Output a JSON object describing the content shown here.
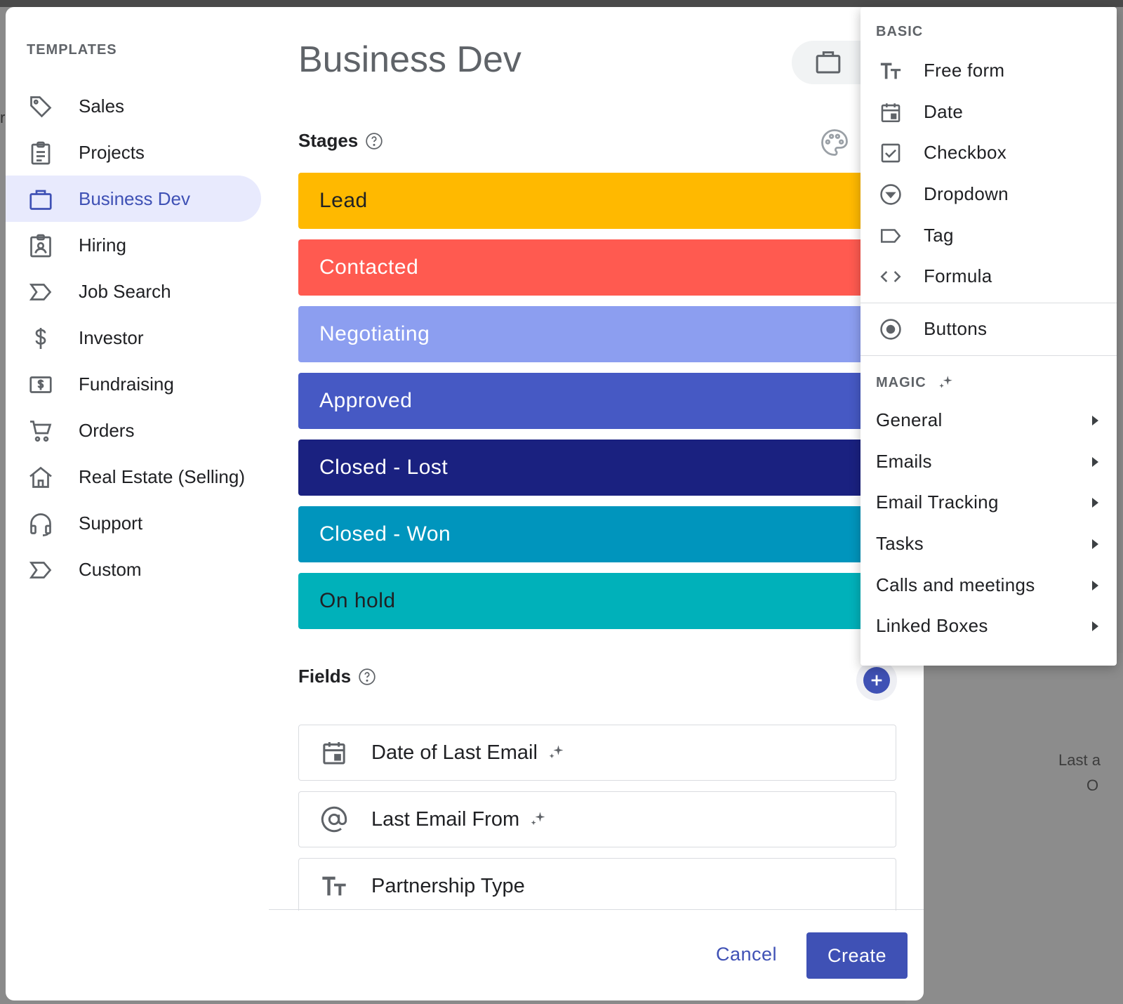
{
  "sidebar": {
    "title": "TEMPLATES",
    "items": [
      {
        "label": "Sales",
        "icon": "tag-icon"
      },
      {
        "label": "Projects",
        "icon": "clipboard-icon"
      },
      {
        "label": "Business Dev",
        "icon": "briefcase-icon",
        "active": true
      },
      {
        "label": "Hiring",
        "icon": "badge-icon"
      },
      {
        "label": "Job Search",
        "icon": "chevron-flag-icon"
      },
      {
        "label": "Investor",
        "icon": "dollar-icon"
      },
      {
        "label": "Fundraising",
        "icon": "money-icon"
      },
      {
        "label": "Orders",
        "icon": "cart-icon"
      },
      {
        "label": "Real Estate (Selling)",
        "icon": "home-icon"
      },
      {
        "label": "Support",
        "icon": "headset-icon"
      },
      {
        "label": "Custom",
        "icon": "chevron-flag-icon"
      }
    ]
  },
  "main": {
    "title": "Business Dev",
    "stages_label": "Stages",
    "stages": [
      {
        "label": "Lead",
        "bg": "#FFB900",
        "fg": "#202124"
      },
      {
        "label": "Contacted",
        "bg": "#FF5A50",
        "fg": "#FFFFFF"
      },
      {
        "label": "Negotiating",
        "bg": "#8C9EF0",
        "fg": "#FFFFFF"
      },
      {
        "label": "Approved",
        "bg": "#4659C4",
        "fg": "#FFFFFF"
      },
      {
        "label": "Closed - Lost",
        "bg": "#1A2180",
        "fg": "#FFFFFF"
      },
      {
        "label": "Closed - Won",
        "bg": "#0095BD",
        "fg": "#FFFFFF"
      },
      {
        "label": "On hold",
        "bg": "#00B1BA",
        "fg": "#202124"
      }
    ],
    "fields_label": "Fields",
    "fields": [
      {
        "label": "Date of Last Email",
        "icon": "calendar-icon",
        "magic": true
      },
      {
        "label": "Last Email From",
        "icon": "at-icon",
        "magic": true
      },
      {
        "label": "Partnership Type",
        "icon": "text-icon",
        "magic": false
      }
    ],
    "cancel_label": "Cancel",
    "create_label": "Create"
  },
  "menu": {
    "basic_label": "BASIC",
    "basic_items": [
      {
        "label": "Free form",
        "icon": "text-icon"
      },
      {
        "label": "Date",
        "icon": "calendar-icon"
      },
      {
        "label": "Checkbox",
        "icon": "checkbox-icon"
      },
      {
        "label": "Dropdown",
        "icon": "dropdown-icon"
      },
      {
        "label": "Tag",
        "icon": "tag-outline-icon"
      },
      {
        "label": "Formula",
        "icon": "code-icon"
      }
    ],
    "buttons_item": {
      "label": "Buttons",
      "icon": "radio-button-icon"
    },
    "magic_label": "MAGIC",
    "magic_items": [
      {
        "label": "General"
      },
      {
        "label": "Emails"
      },
      {
        "label": "Email Tracking"
      },
      {
        "label": "Tasks"
      },
      {
        "label": "Calls and meetings"
      },
      {
        "label": "Linked Boxes"
      }
    ]
  },
  "background": {
    "text_1": "Last a",
    "text_2": "O"
  },
  "colors": {
    "accent": "#3F51B5",
    "active_bg": "#E8EAFD"
  }
}
